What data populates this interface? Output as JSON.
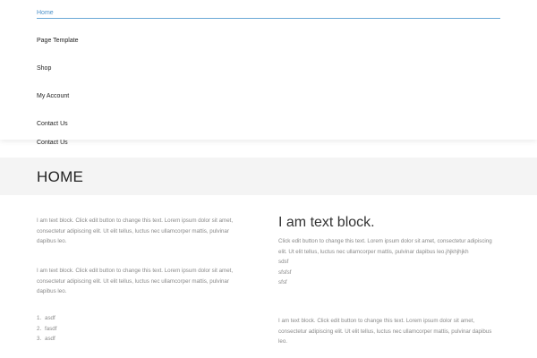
{
  "nav": {
    "items": [
      {
        "label": "Home",
        "active": true
      },
      {
        "label": "Page Template",
        "active": false
      },
      {
        "label": "Shop",
        "active": false
      },
      {
        "label": "My Account",
        "active": false
      },
      {
        "label": "Contact Us",
        "active": false
      }
    ],
    "sticky_item": "Contact Us",
    "active_color": "#4a90c8"
  },
  "page": {
    "title": "HOME",
    "hero_bg": "#f4f4f4"
  },
  "left": {
    "paragraphs": [
      "I am text block. Click edit button to change this text. Lorem ipsum dolor sit amet, consectetur adipiscing elit. Ut elit tellus, luctus nec ullamcorper mattis, pulvinar dapibus leo.",
      "I am text block. Click edit button to change this text. Lorem ipsum dolor sit amet, consectetur adipiscing elit. Ut elit tellus, luctus nec ullamcorper mattis, pulvinar dapibus leo."
    ],
    "list": [
      {
        "num": "1.",
        "text": "asdf"
      },
      {
        "num": "2.",
        "text": "fasdf"
      },
      {
        "num": "3.",
        "text": "asdf"
      }
    ]
  },
  "right": {
    "heading": "I am text block.",
    "body": "Click edit button to change this text. Lorem ipsum dolor sit amet, consectetur adipiscing elit. Ut elit tellus, luctus nec ullamcorper mattis, pulvinar dapibus leo.jhjkhjhjkh",
    "lines": [
      "sdsf",
      "sfsfsf",
      "sfsf"
    ],
    "paragraph": "I am text block. Click edit button to change this text. Lorem ipsum dolor sit amet, consectetur adipiscing elit. Ut elit tellus, luctus nec ullamcorper mattis, pulvinar dapibus leo."
  }
}
